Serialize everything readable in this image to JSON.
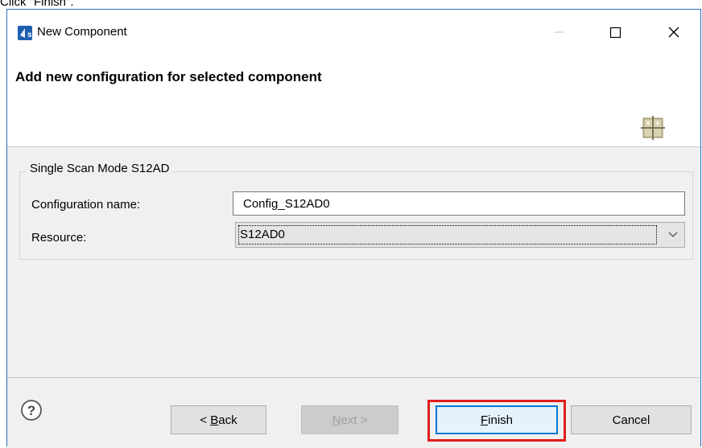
{
  "caption": "Click \"Finish\".",
  "window": {
    "title": "New Component",
    "header_title": "Add new configuration for selected component"
  },
  "group": {
    "legend": "Single Scan Mode S12AD",
    "config_label": "Configuration name:",
    "config_value": "Config_S12AD0",
    "resource_label": "Resource:",
    "resource_value": "S12AD0"
  },
  "buttons": {
    "back_prefix": "< ",
    "back_mnemonic": "B",
    "back_rest": "ack",
    "next_mnemonic": "N",
    "next_rest": "ext >",
    "finish_mnemonic": "F",
    "finish_rest": "inish",
    "cancel": "Cancel"
  },
  "icons": {
    "app": "renesas-app-icon",
    "wizard": "component-grid-icon",
    "help": "help-icon"
  },
  "colors": {
    "accent": "#0078d7",
    "highlight": "#e01e1e",
    "window_border": "#2b6fc1"
  }
}
